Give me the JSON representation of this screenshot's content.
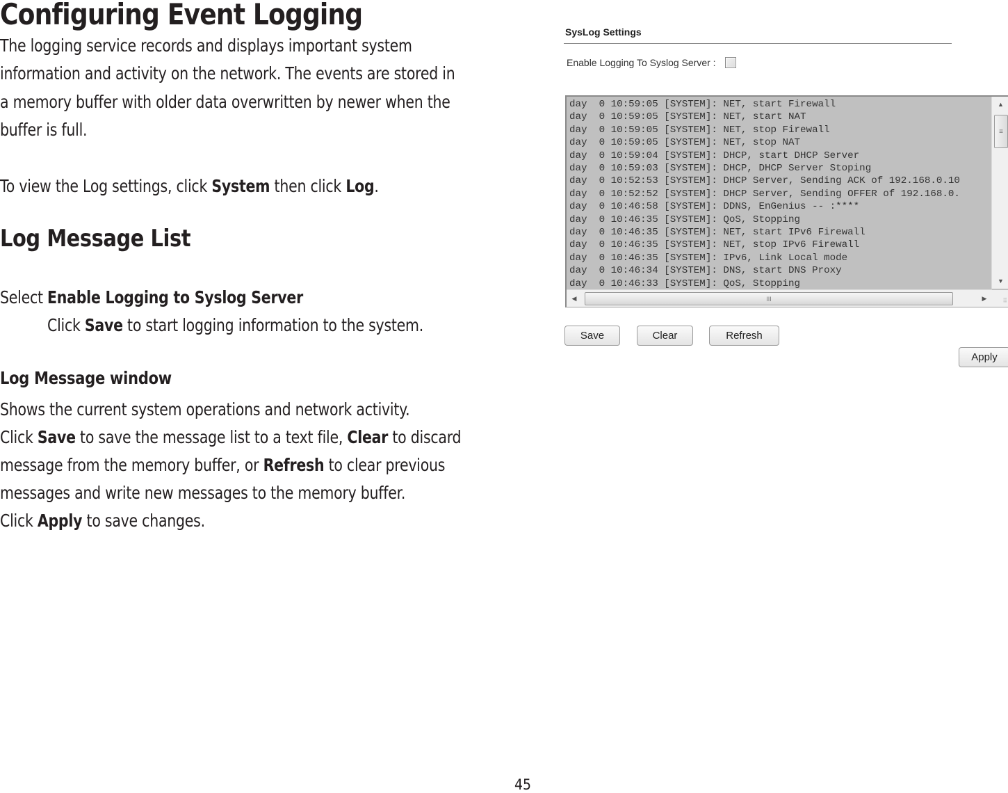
{
  "document": {
    "title": "Configuring Event Logging",
    "intro_lines": [
      "The logging service records and displays important system",
      "information and activity on the network. The events are stored in",
      "a memory buffer with older data overwritten by newer when the",
      "buffer is full."
    ],
    "view_instruction": {
      "prefix": "To view the Log settings, click ",
      "system": "System",
      "middle": " then click ",
      "log": "Log",
      "suffix": "."
    },
    "section_heading": "Log Message List",
    "select_line": {
      "prefix": "Select ",
      "bold": "Enable Logging to Syslog Server"
    },
    "click_save_line": {
      "prefix": "Click ",
      "bold": "Save",
      "suffix": " to start logging information to the system."
    },
    "subsection_heading": "Log Message window",
    "window_lines": {
      "line1": "Shows the current system operations and network activity.",
      "line2_prefix": "Click ",
      "line2_save": "Save",
      "line2_mid": " to save the message list to a text file, ",
      "line2_clear": "Clear",
      "line2_suffix": " to discard",
      "line3_prefix": "message from the memory buffer, or ",
      "line3_refresh": "Refresh",
      "line3_suffix": " to clear previous",
      "line4": "messages and write new messages to the memory buffer.",
      "line5_prefix": "Click ",
      "line5_apply": "Apply",
      "line5_suffix": " to save changes."
    },
    "page_number": "45"
  },
  "ui": {
    "section_title": "SysLog Settings",
    "enable_label": "Enable Logging To Syslog Server :",
    "enable_checked": false,
    "log_lines": [
      "day  0 10:59:05 [SYSTEM]: NET, start Firewall",
      "day  0 10:59:05 [SYSTEM]: NET, start NAT",
      "day  0 10:59:05 [SYSTEM]: NET, stop Firewall",
      "day  0 10:59:05 [SYSTEM]: NET, stop NAT",
      "day  0 10:59:04 [SYSTEM]: DHCP, start DHCP Server",
      "day  0 10:59:03 [SYSTEM]: DHCP, DHCP Server Stoping",
      "day  0 10:52:53 [SYSTEM]: DHCP Server, Sending ACK of 192.168.0.10",
      "day  0 10:52:52 [SYSTEM]: DHCP Server, Sending OFFER of 192.168.0.",
      "day  0 10:46:58 [SYSTEM]: DDNS, EnGenius -- :****",
      "day  0 10:46:35 [SYSTEM]: QoS, Stopping",
      "day  0 10:46:35 [SYSTEM]: NET, start IPv6 Firewall",
      "day  0 10:46:35 [SYSTEM]: NET, stop IPv6 Firewall",
      "day  0 10:46:35 [SYSTEM]: IPv6, Link Local mode",
      "day  0 10:46:34 [SYSTEM]: DNS, start DNS Proxy",
      "day  0 10:46:33 [SYSTEM]: QoS, Stopping"
    ],
    "icons": {
      "scroll_up": "▲",
      "scroll_down": "▼",
      "scroll_left": "◀",
      "scroll_right": "▶",
      "thumb_grip_v": "≡",
      "thumb_grip_h": "III",
      "resize_grip": "⠿"
    },
    "buttons": {
      "save": "Save",
      "clear": "Clear",
      "refresh": "Refresh",
      "apply": "Apply"
    }
  }
}
